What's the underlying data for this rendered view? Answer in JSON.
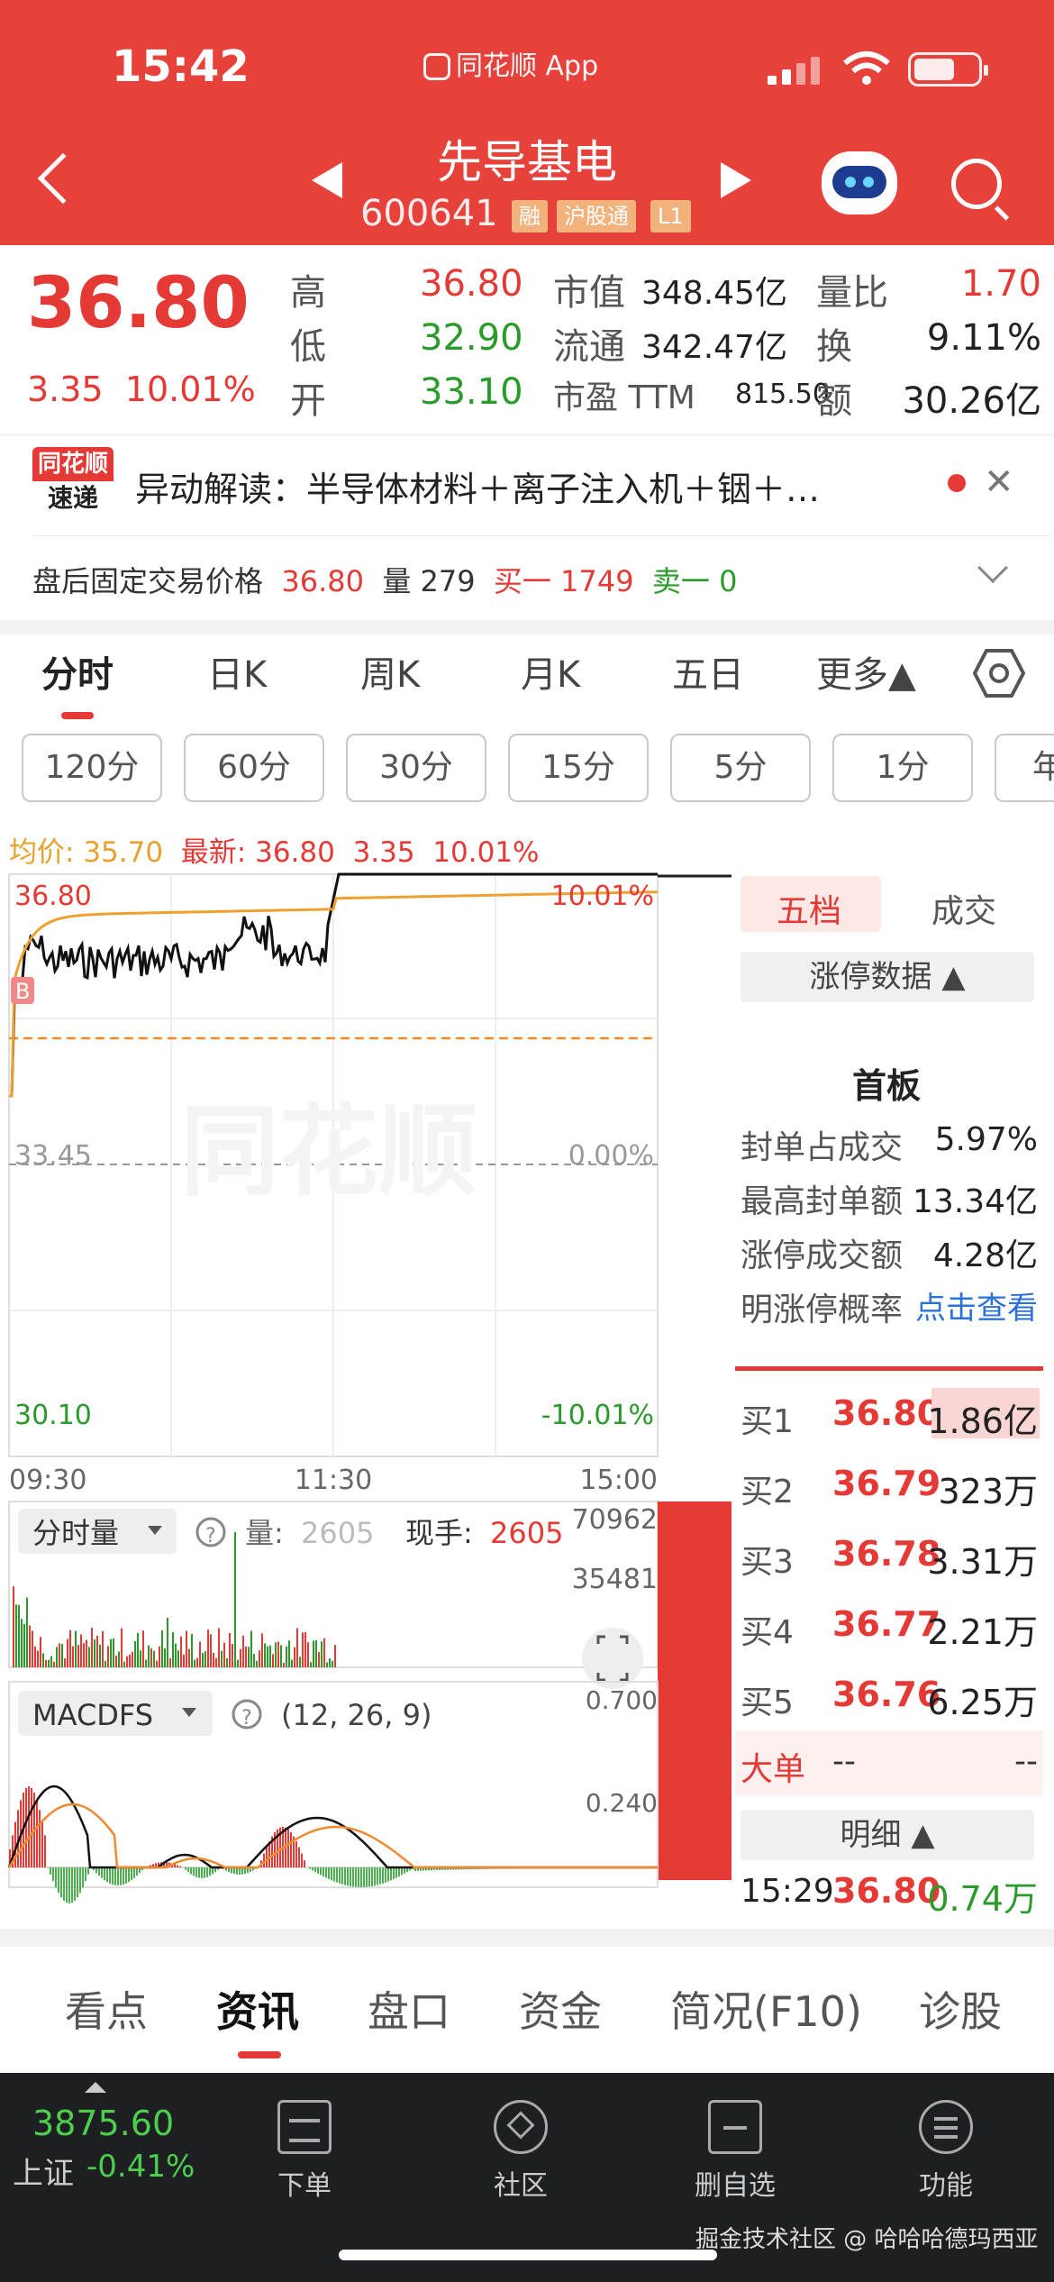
{
  "status_bar": {
    "time": "15:42",
    "app": "同花顺 App"
  },
  "header": {
    "title": "先导基电",
    "code": "600641",
    "tags": [
      "融",
      "沪股通",
      "L1"
    ]
  },
  "quote": {
    "price": "36.80",
    "change": "3.35",
    "change_pct": "10.01%",
    "rows": [
      {
        "l1": "高",
        "v1": "36.80",
        "l2": "市值",
        "v2": "348.45亿",
        "l3": "量比",
        "v3": "1.70"
      },
      {
        "l1": "低",
        "v1": "32.90",
        "l2": "流通",
        "v2": "342.47亿",
        "l3": "换",
        "v3": "9.11%"
      },
      {
        "l1": "开",
        "v1": "33.10",
        "l2": "市盈 TTM",
        "v2": "815.50",
        "l3": "额",
        "v3": "30.26亿"
      }
    ]
  },
  "news": {
    "logo_top": "同花顺",
    "logo_bottom": "速递",
    "text": "异动解读：半导体材料＋离子注入机＋铟＋…",
    "after_hours_label": "盘后固定交易价格",
    "after_hours_price": "36.80",
    "vol_label": "量",
    "vol": "279",
    "buy1_label": "买一",
    "buy1": "1749",
    "sell1_label": "卖一",
    "sell1": "0"
  },
  "period_tabs": [
    "分时",
    "日K",
    "周K",
    "月K",
    "五日",
    "更多▲"
  ],
  "minute_pills": [
    "120分",
    "60分",
    "30分",
    "15分",
    "5分",
    "1分",
    "年"
  ],
  "summary": {
    "avg_label": "均价:",
    "avg": "35.70",
    "latest_label": "最新:",
    "latest": "36.80",
    "chg": "3.35",
    "pct": "10.01%"
  },
  "chart_data": {
    "type": "line",
    "price_top": "36.80",
    "price_mid": "33.45",
    "price_bottom": "30.10",
    "pct_top": "10.01%",
    "pct_mid": "0.00%",
    "pct_bottom": "-10.01%",
    "x_labels": [
      "09:30",
      "11:30",
      "15:00"
    ],
    "watermark": "同花顺",
    "marker": "B",
    "volume": {
      "label": "分时量",
      "qty_label": "量:",
      "qty": "2605",
      "cur_label": "现手:",
      "cur": "2605",
      "ticks": [
        "70962",
        "35481"
      ]
    },
    "macd": {
      "label": "MACDFS",
      "params": "(12, 26, 9)",
      "ticks": [
        "0.700",
        "0.240"
      ]
    }
  },
  "orderbook": {
    "tabs": [
      "五档",
      "成交"
    ],
    "limit_label": "涨停数据 ▲",
    "board": "首板",
    "stats": [
      {
        "k": "封单占成交",
        "v": "5.97%"
      },
      {
        "k": "最高封单额",
        "v": "13.34亿"
      },
      {
        "k": "涨停成交额",
        "v": "4.28亿"
      },
      {
        "k": "明涨停概率",
        "v": "点击查看"
      }
    ],
    "bids": [
      {
        "k": "买1",
        "p": "36.80",
        "v": "1.86亿"
      },
      {
        "k": "买2",
        "p": "36.79",
        "v": "323万"
      },
      {
        "k": "买3",
        "p": "36.78",
        "v": "3.31万"
      },
      {
        "k": "买4",
        "p": "36.77",
        "v": "2.21万"
      },
      {
        "k": "买5",
        "p": "36.76",
        "v": "6.25万"
      }
    ],
    "big_label": "大单",
    "big_v1": "--",
    "big_v2": "--",
    "detail_label": "明细 ▲",
    "trade": {
      "time": "15:29",
      "price": "36.80",
      "vol": "0.74万"
    }
  },
  "bottom_tabs": [
    "看点",
    "资讯",
    "盘口",
    "资金",
    "简况(F10)",
    "诊股"
  ],
  "footer": {
    "index_value": "3875.60",
    "index_name": "上证",
    "index_chg": "-0.41%",
    "items": [
      "下单",
      "社区",
      "删自选",
      "功能"
    ],
    "credit": "掘金技术社区 @ 哈哈哈德玛西亚"
  }
}
